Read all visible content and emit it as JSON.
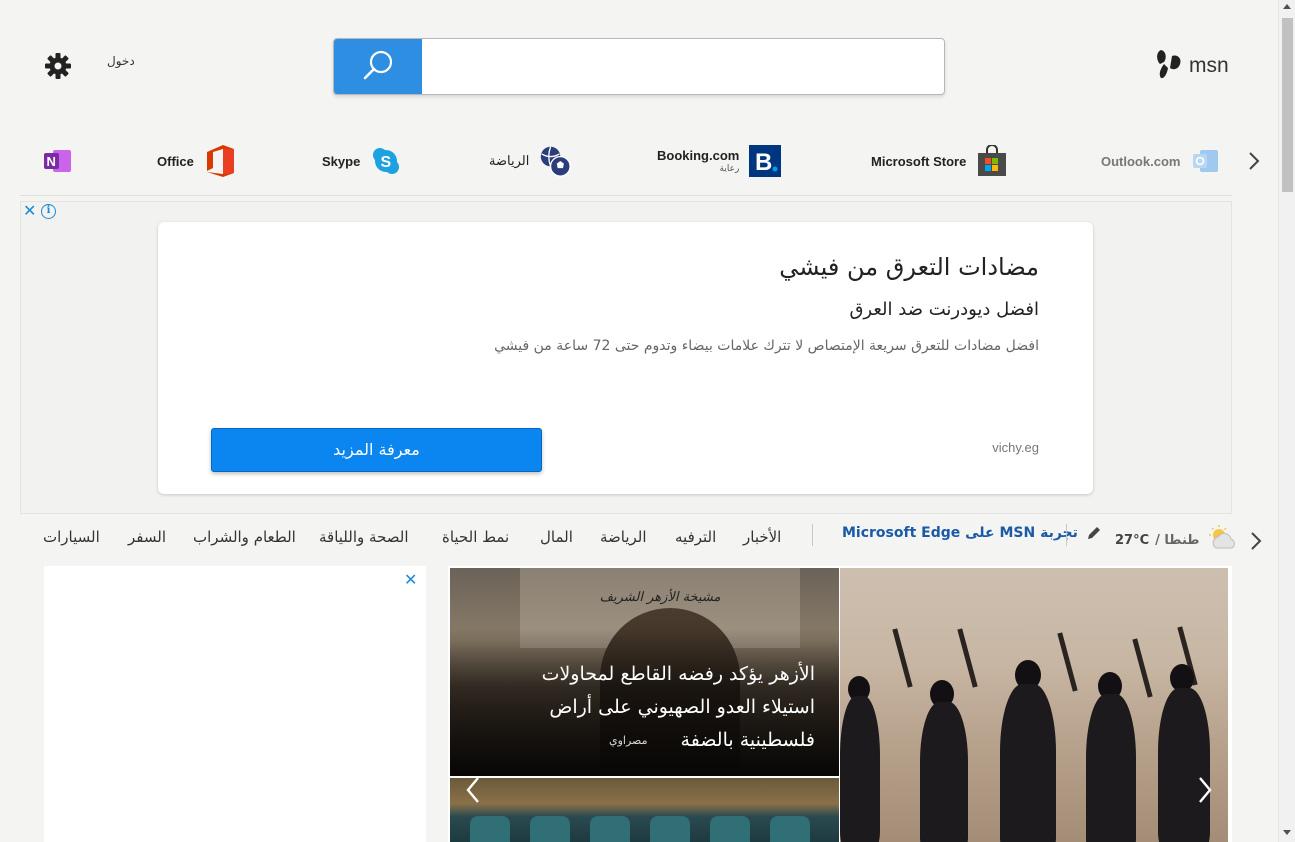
{
  "header": {
    "settings_icon": "gear-icon",
    "signin_label": "دخول",
    "search_placeholder": "",
    "search_value": "",
    "logo_text": "msn"
  },
  "quicklinks": [
    {
      "label": "Outlook.com",
      "sub": "",
      "icon": "outlook-icon",
      "color": "#1a6fc4"
    },
    {
      "label": "Microsoft Store",
      "sub": "",
      "icon": "store-icon",
      "color": "#555555"
    },
    {
      "label": "Booking.com",
      "sub": "رعاية",
      "icon": "booking-icon",
      "color": "#003580"
    },
    {
      "label": "الرياضة",
      "sub": "",
      "icon": "sports-icon",
      "color": "#2b3d7a"
    },
    {
      "label": "Skype",
      "sub": "",
      "icon": "skype-icon",
      "color": "#1ea1e0"
    },
    {
      "label": "Office",
      "sub": "",
      "icon": "office-icon",
      "color": "#d83b01"
    },
    {
      "label": "",
      "sub": "",
      "icon": "onenote-icon",
      "color": "#7a2ca4"
    }
  ],
  "ad": {
    "title": "مضادات التعرق من فيشي",
    "subtitle": "افضل ديودرنت ضد العرق",
    "description": "افضل مضادات للتعرق سريعة الإمتصاص لا تترك علامات بيضاء وتدوم حتى 72 ساعة من فيشي",
    "domain": "vichy.eg",
    "cta": "معرفة المزيد",
    "close_glyph": "✕",
    "info_glyph": "i"
  },
  "nav": {
    "weather_city": "طنطا /",
    "weather_temp": "27°C",
    "edge_link": "تجربة MSN على Microsoft Edge",
    "categories": [
      "الأخبار",
      "الترفيه",
      "الرياضة",
      "المال",
      "نمط الحياة",
      "الصحة واللياقة",
      "الطعام والشراب",
      "السفر",
      "السيارات"
    ]
  },
  "side_ad": {
    "close_glyph": "✕"
  },
  "hero": {
    "headline": "الأزهر يؤكد رفضه القاطع لمحاولات استيلاء العدو الصهيوني على أراض فلسطينية بالضفة",
    "source": "مصراوي",
    "sign_text": "مشيخة الأزهر الشريف"
  },
  "colors": {
    "accent": "#2d8ee2",
    "cta": "#0b86f0",
    "link": "#1a5aa6",
    "background": "#f4f4f2"
  }
}
